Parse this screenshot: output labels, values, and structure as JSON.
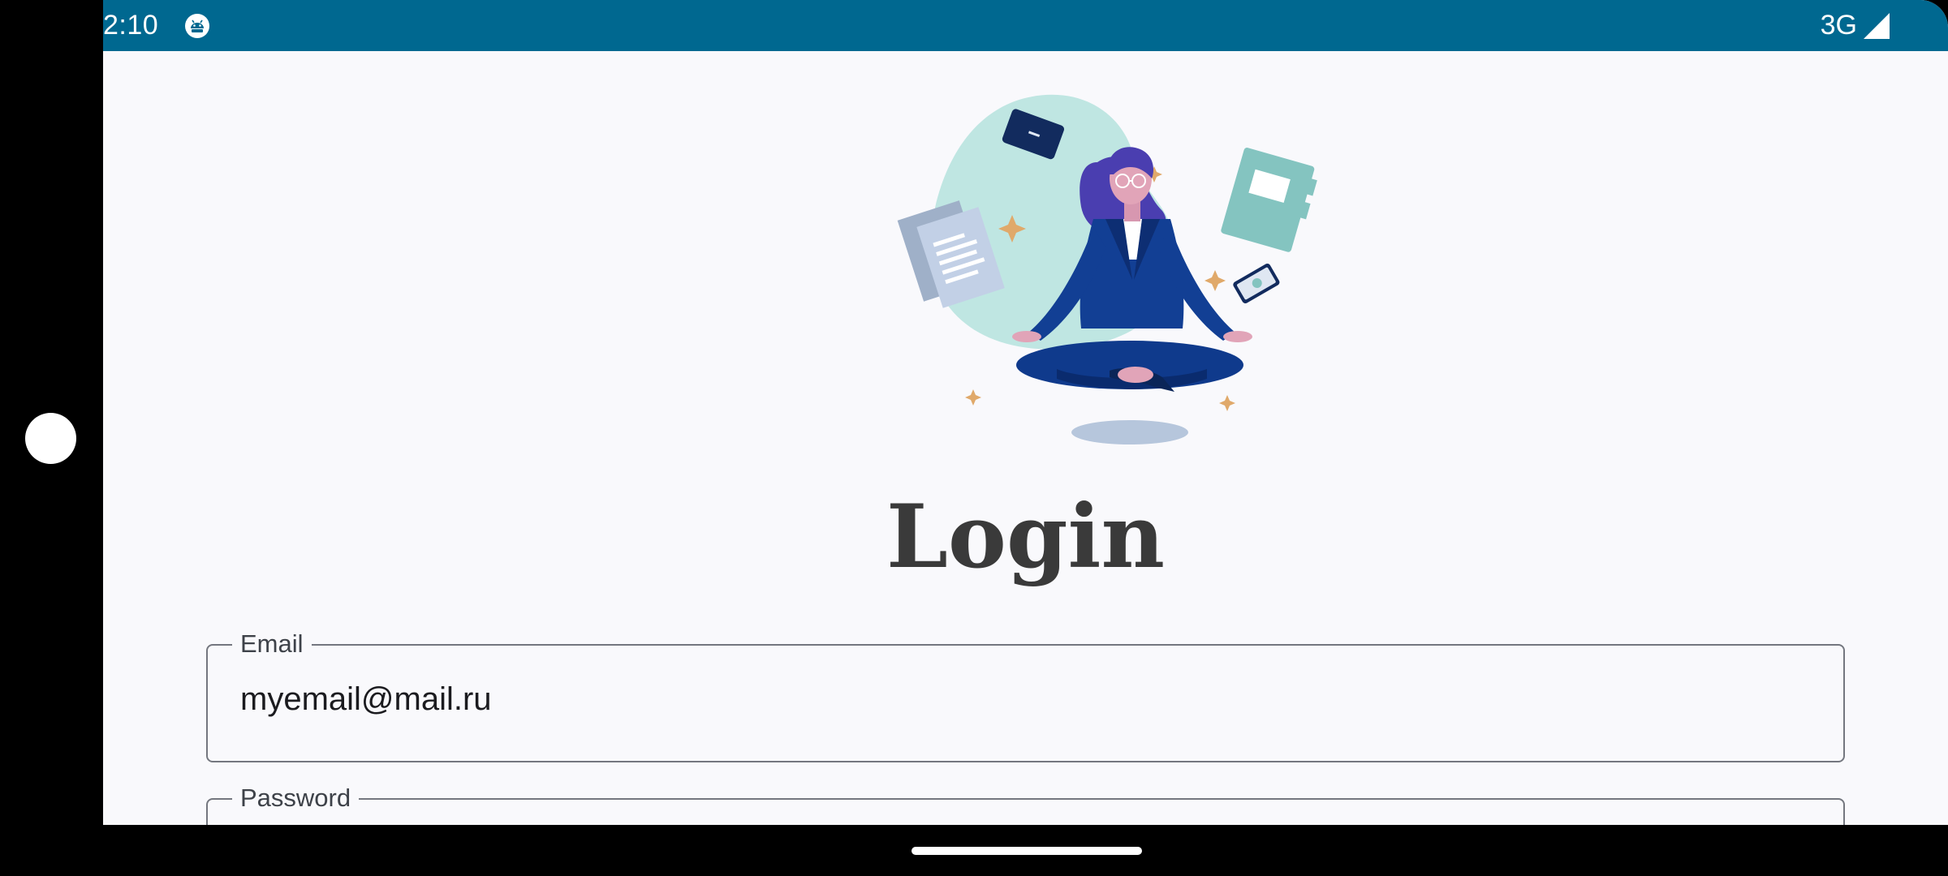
{
  "status_bar": {
    "time": "2:10",
    "app_icon": "android-debug-icon",
    "network": "3G",
    "signal_icon": "cell-signal-icon"
  },
  "illustration": {
    "name": "meditating-woman-illustration"
  },
  "login": {
    "title": "Login",
    "email_label": "Email",
    "email_value": "myemail@mail.ru",
    "password_label": "Password"
  },
  "colors": {
    "status_bar": "#006890",
    "background": "#f9f9fc",
    "title": "#3a3a3a"
  }
}
